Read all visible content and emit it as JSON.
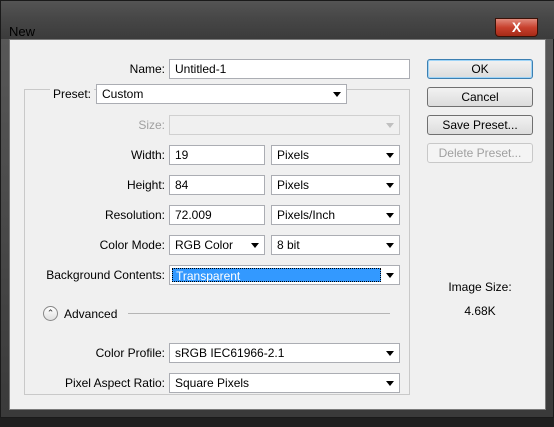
{
  "window": {
    "title": "New",
    "close_glyph": "X"
  },
  "name": {
    "label": "Name:",
    "value": "Untitled-1"
  },
  "preset": {
    "label": "Preset:",
    "value": "Custom"
  },
  "size": {
    "label": "Size:",
    "value": ""
  },
  "width": {
    "label": "Width:",
    "value": "19",
    "unit": "Pixels"
  },
  "height": {
    "label": "Height:",
    "value": "84",
    "unit": "Pixels"
  },
  "resolution": {
    "label": "Resolution:",
    "value": "72.009",
    "unit": "Pixels/Inch"
  },
  "color_mode": {
    "label": "Color Mode:",
    "value": "RGB Color",
    "depth": "8 bit"
  },
  "background": {
    "label": "Background Contents:",
    "value": "Transparent"
  },
  "advanced": {
    "label": "Advanced",
    "icon": "collapse-chevron-icon"
  },
  "color_profile": {
    "label": "Color Profile:",
    "value": "sRGB IEC61966-2.1"
  },
  "pixel_aspect": {
    "label": "Pixel Aspect Ratio:",
    "value": "Square Pixels"
  },
  "buttons": {
    "ok": "OK",
    "cancel": "Cancel",
    "save_preset": "Save Preset...",
    "delete_preset": "Delete Preset..."
  },
  "image_size": {
    "label": "Image Size:",
    "value": "4.68K"
  },
  "colors": {
    "selection": "#3399ff",
    "close_button": "#c8412e",
    "default_button_border": "#3c7fb1"
  }
}
